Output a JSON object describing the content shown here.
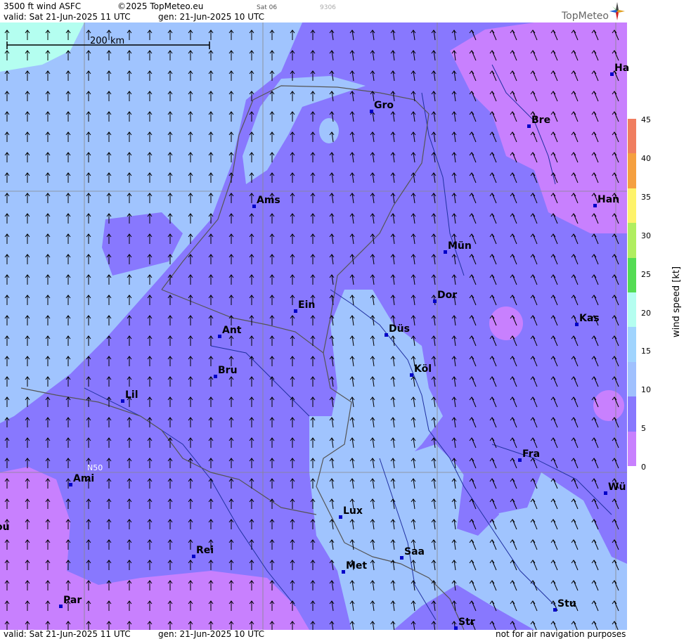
{
  "header": {
    "title": "3500 ft wind ASFC",
    "copyright": "©2025 TopMeteo.eu",
    "day_code": "Sat 06",
    "code2": "9306",
    "valid": "valid:  Sat  21-Jun-2025  11 UTC",
    "gen": "gen: 21-Jun-2025 10 UTC"
  },
  "footer": {
    "valid": "valid:  Sat  21-Jun-2025  11 UTC",
    "gen": "gen: 21-Jun-2025 10 UTC",
    "notice": "not for air navigation purposes"
  },
  "logo": {
    "text": "TopMeteo"
  },
  "scale": {
    "label": "200 km"
  },
  "lat_label": "N50",
  "legend": {
    "title": "wind  speed  [kt]",
    "ticks": [
      "45",
      "40",
      "35",
      "30",
      "25",
      "20",
      "15",
      "10",
      "5",
      "0"
    ],
    "colors": [
      "#f07e60",
      "#f5a040",
      "#fef36a",
      "#b0ee60",
      "#54dc54",
      "#b4fef0",
      "#a0d4fe",
      "#a0c0fe",
      "#8878fe",
      "#c880fe"
    ]
  },
  "cities": [
    {
      "name": "Gro"
    },
    {
      "name": "Bre"
    },
    {
      "name": "Ha"
    },
    {
      "name": "Ams"
    },
    {
      "name": "Han"
    },
    {
      "name": "Mün"
    },
    {
      "name": "Ein"
    },
    {
      "name": "Dor"
    },
    {
      "name": "Ant"
    },
    {
      "name": "Düs"
    },
    {
      "name": "Kas"
    },
    {
      "name": "Bru"
    },
    {
      "name": "Köl"
    },
    {
      "name": "Lil"
    },
    {
      "name": "Fra"
    },
    {
      "name": "Ami"
    },
    {
      "name": "Wü"
    },
    {
      "name": "Lux"
    },
    {
      "name": "ou"
    },
    {
      "name": "Rei"
    },
    {
      "name": "Saa"
    },
    {
      "name": "Met"
    },
    {
      "name": "Stu"
    },
    {
      "name": "Par"
    },
    {
      "name": "Str"
    }
  ],
  "colors": {
    "zone_lilac": "#c880fe",
    "zone_purple": "#8878fe",
    "zone_blue": "#a0c4fe",
    "zone_cyan": "#b4fef0",
    "arrow": "#000000",
    "border": "#555555",
    "river": "#2030a0",
    "grid": "#888888"
  }
}
